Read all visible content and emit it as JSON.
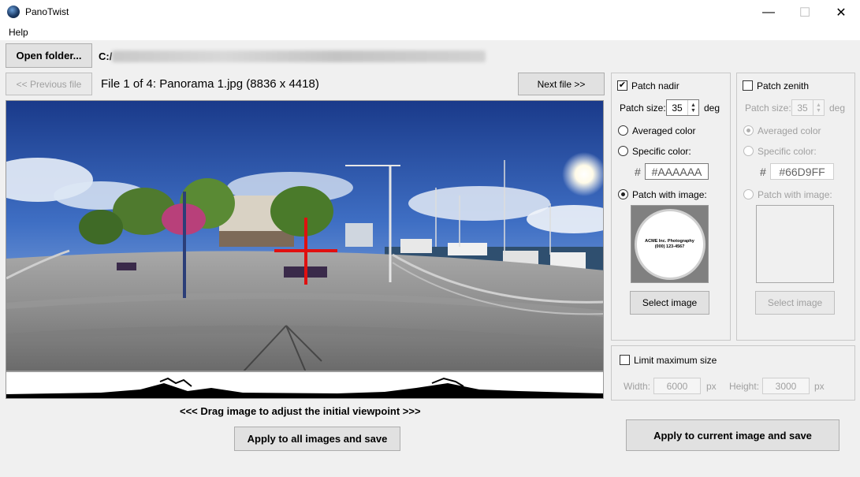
{
  "window": {
    "title": "PanoTwist",
    "minimize": "—",
    "maximize": "☐",
    "close": "✕"
  },
  "menu": {
    "help": "Help"
  },
  "toolbar": {
    "open_folder": "Open folder...",
    "path_prefix": "C:/"
  },
  "nav": {
    "previous": "<< Previous file",
    "next": "Next file >>",
    "file_info": "File 1 of 4: Panorama 1.jpg (8836 x 4418)"
  },
  "hint": "<<<   Drag image to adjust the initial viewpoint   >>>",
  "apply_all": "Apply to all images and save",
  "apply_current": "Apply to current image and save",
  "nadir": {
    "enabled_label": "Patch nadir",
    "checked": "✔",
    "patch_size_label": "Patch size:",
    "patch_size": "35",
    "unit": "deg",
    "averaged": "Averaged color",
    "specific": "Specific color:",
    "hash": "#",
    "color": "#AAAAAA",
    "with_image": "Patch with image:",
    "logo_line1": "ACME Inc. Photography",
    "logo_line2": "(000) 123-4567",
    "select_image": "Select image",
    "selected_mode": "image"
  },
  "zenith": {
    "enabled_label": "Patch zenith",
    "patch_size_label": "Patch size:",
    "patch_size": "35",
    "unit": "deg",
    "averaged": "Averaged color",
    "specific": "Specific color:",
    "hash": "#",
    "color": "#66D9FF",
    "with_image": "Patch with image:",
    "select_image": "Select image",
    "selected_mode": "averaged"
  },
  "limit": {
    "label": "Limit maximum size",
    "width_label": "Width:",
    "width": "6000",
    "height_label": "Height:",
    "height": "3000",
    "unit": "px"
  },
  "colors": {
    "crosshair": "#e01010",
    "window_bg": "#f0f0f0",
    "button_bg": "#e1e1e1"
  }
}
